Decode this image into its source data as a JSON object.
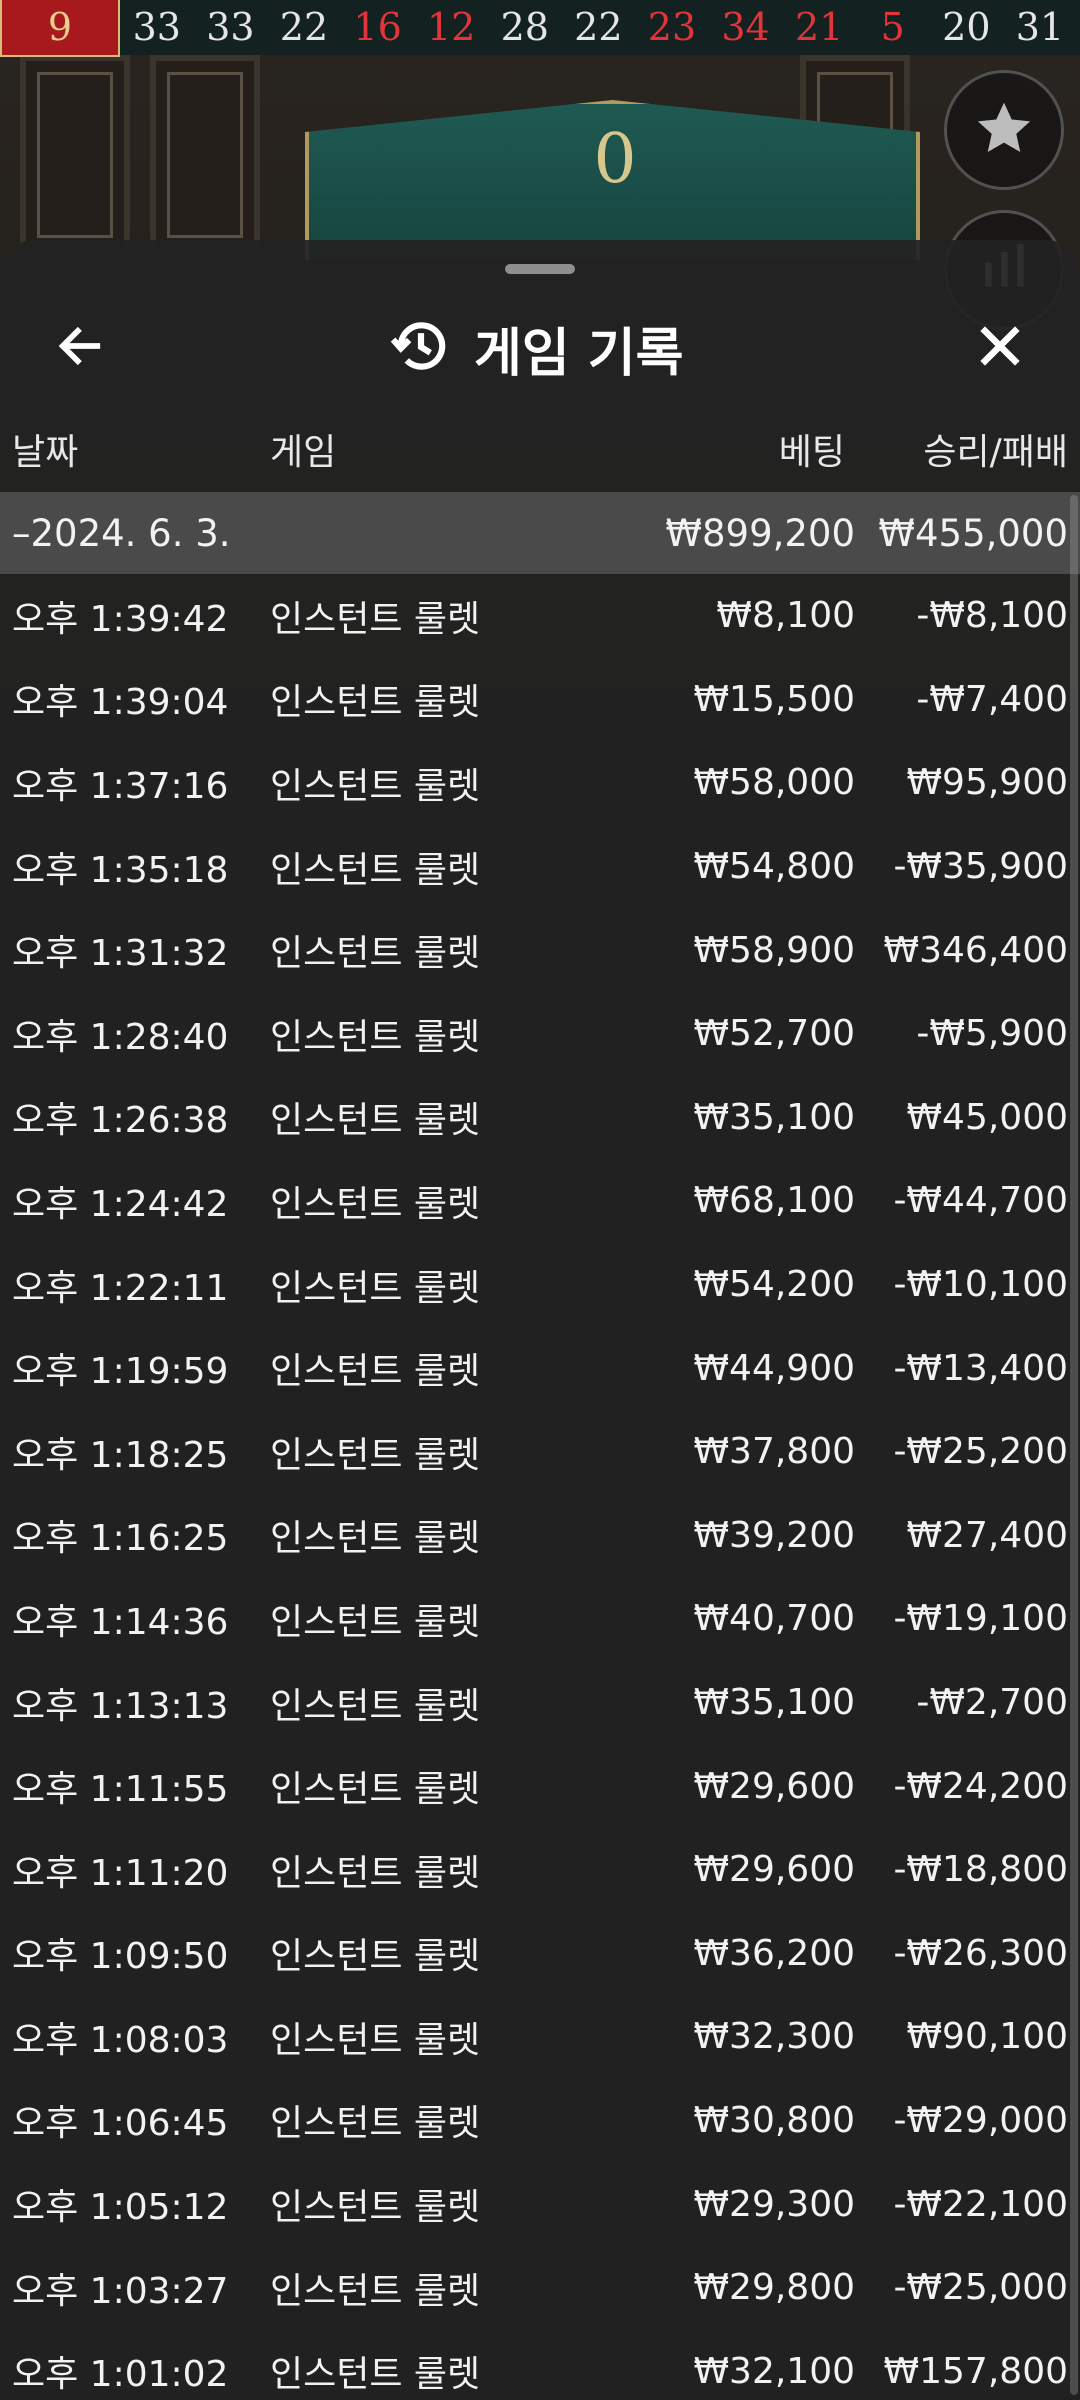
{
  "history_strip": {
    "numbers": [
      {
        "value": "9",
        "color": "red",
        "latest": true
      },
      {
        "value": "33",
        "color": "black"
      },
      {
        "value": "33",
        "color": "black"
      },
      {
        "value": "22",
        "color": "black"
      },
      {
        "value": "16",
        "color": "red"
      },
      {
        "value": "12",
        "color": "red"
      },
      {
        "value": "28",
        "color": "black"
      },
      {
        "value": "22",
        "color": "black"
      },
      {
        "value": "23",
        "color": "red"
      },
      {
        "value": "34",
        "color": "red"
      },
      {
        "value": "21",
        "color": "red"
      },
      {
        "value": "5",
        "color": "red"
      },
      {
        "value": "20",
        "color": "black"
      },
      {
        "value": "31",
        "color": "black"
      }
    ]
  },
  "game": {
    "zero_label": "0",
    "favorite_icon": "star-icon",
    "stats_icon": "stats-icon"
  },
  "sheet": {
    "title": "게임 기록",
    "title_icon": "history-icon",
    "back_icon": "arrow-left-icon",
    "close_icon": "close-icon",
    "columns": {
      "date": "날짜",
      "game": "게임",
      "bet": "베팅",
      "result": "승리/패배"
    },
    "date_group": {
      "date": "–2024. 6. 3.",
      "total_bet": "₩899,200",
      "total_result": "₩455,000"
    },
    "rows": [
      {
        "time": "오후 1:39:42",
        "game": "인스턴트 룰렛",
        "bet": "₩8,100",
        "result": "-₩8,100"
      },
      {
        "time": "오후 1:39:04",
        "game": "인스턴트 룰렛",
        "bet": "₩15,500",
        "result": "-₩7,400"
      },
      {
        "time": "오후 1:37:16",
        "game": "인스턴트 룰렛",
        "bet": "₩58,000",
        "result": "₩95,900"
      },
      {
        "time": "오후 1:35:18",
        "game": "인스턴트 룰렛",
        "bet": "₩54,800",
        "result": "-₩35,900"
      },
      {
        "time": "오후 1:31:32",
        "game": "인스턴트 룰렛",
        "bet": "₩58,900",
        "result": "₩346,400"
      },
      {
        "time": "오후 1:28:40",
        "game": "인스턴트 룰렛",
        "bet": "₩52,700",
        "result": "-₩5,900"
      },
      {
        "time": "오후 1:26:38",
        "game": "인스턴트 룰렛",
        "bet": "₩35,100",
        "result": "₩45,000"
      },
      {
        "time": "오후 1:24:42",
        "game": "인스턴트 룰렛",
        "bet": "₩68,100",
        "result": "-₩44,700"
      },
      {
        "time": "오후 1:22:11",
        "game": "인스턴트 룰렛",
        "bet": "₩54,200",
        "result": "-₩10,100"
      },
      {
        "time": "오후 1:19:59",
        "game": "인스턴트 룰렛",
        "bet": "₩44,900",
        "result": "-₩13,400"
      },
      {
        "time": "오후 1:18:25",
        "game": "인스턴트 룰렛",
        "bet": "₩37,800",
        "result": "-₩25,200"
      },
      {
        "time": "오후 1:16:25",
        "game": "인스턴트 룰렛",
        "bet": "₩39,200",
        "result": "₩27,400"
      },
      {
        "time": "오후 1:14:36",
        "game": "인스턴트 룰렛",
        "bet": "₩40,700",
        "result": "-₩19,100"
      },
      {
        "time": "오후 1:13:13",
        "game": "인스턴트 룰렛",
        "bet": "₩35,100",
        "result": "-₩2,700"
      },
      {
        "time": "오후 1:11:55",
        "game": "인스턴트 룰렛",
        "bet": "₩29,600",
        "result": "-₩24,200"
      },
      {
        "time": "오후 1:11:20",
        "game": "인스턴트 룰렛",
        "bet": "₩29,600",
        "result": "-₩18,800"
      },
      {
        "time": "오후 1:09:50",
        "game": "인스턴트 룰렛",
        "bet": "₩36,200",
        "result": "-₩26,300"
      },
      {
        "time": "오후 1:08:03",
        "game": "인스턴트 룰렛",
        "bet": "₩32,300",
        "result": "₩90,100"
      },
      {
        "time": "오후 1:06:45",
        "game": "인스턴트 룰렛",
        "bet": "₩30,800",
        "result": "-₩29,000"
      },
      {
        "time": "오후 1:05:12",
        "game": "인스턴트 룰렛",
        "bet": "₩29,300",
        "result": "-₩22,100"
      },
      {
        "time": "오후 1:03:27",
        "game": "인스턴트 룰렛",
        "bet": "₩29,800",
        "result": "-₩25,000"
      },
      {
        "time": "오후 1:01:02",
        "game": "인스턴트 룰렛",
        "bet": "₩32,100",
        "result": "₩157,800"
      }
    ]
  },
  "colors": {
    "accent_red": "#a8191d",
    "gold": "#d8bb7b",
    "table_green": "#1f5a52",
    "sheet_bg": "#222222"
  }
}
